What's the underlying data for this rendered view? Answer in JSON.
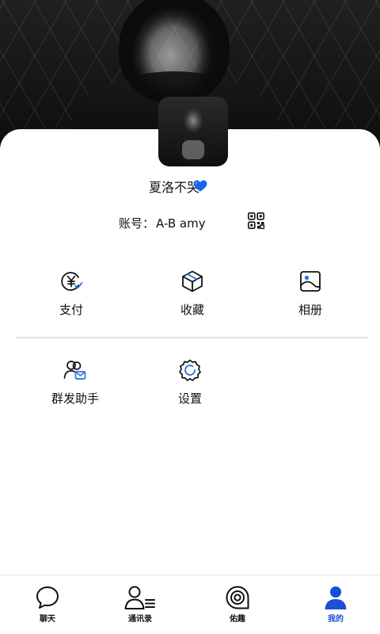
{
  "profile": {
    "nickname": "夏洛不哭",
    "heart_emoji": "💙",
    "account_label": "账号：",
    "account_value": "A-B amy"
  },
  "menu": {
    "row1": [
      {
        "label": "支付",
        "icon": "yuan-payment-icon"
      },
      {
        "label": "收藏",
        "icon": "box-favorites-icon"
      },
      {
        "label": "相册",
        "icon": "photo-album-icon"
      }
    ],
    "row2": [
      {
        "label": "群发助手",
        "icon": "group-message-icon"
      },
      {
        "label": "设置",
        "icon": "settings-gear-icon"
      }
    ]
  },
  "tabbar": {
    "tabs": [
      {
        "label": "聊天",
        "icon": "chat-bubble-icon"
      },
      {
        "label": "通讯录",
        "icon": "contacts-icon"
      },
      {
        "label": "佑趣",
        "icon": "discover-icon"
      },
      {
        "label": "我的",
        "icon": "me-person-icon",
        "active": true
      }
    ]
  },
  "colors": {
    "accent": "#1a4fd6",
    "heart": "#1565e8",
    "icon_blue": "#2b6fe0"
  }
}
